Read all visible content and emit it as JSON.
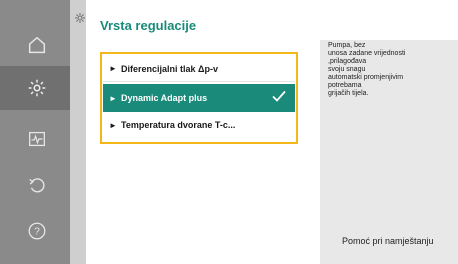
{
  "header": {
    "title": "Vrsta regulacije"
  },
  "nav": {
    "items": [
      {
        "icon": "home-icon",
        "active": false
      },
      {
        "icon": "gear-icon",
        "active": true
      },
      {
        "icon": "pulse-icon",
        "active": false
      },
      {
        "icon": "undo-icon",
        "active": false
      },
      {
        "icon": "help-icon",
        "active": false
      }
    ]
  },
  "list": {
    "items": [
      {
        "label": "Diferencijalni tlak Δp-v",
        "selected": false
      },
      {
        "label": "Dynamic Adapt plus",
        "selected": true
      },
      {
        "label": "Temperatura dvorane T-c...",
        "selected": false
      }
    ]
  },
  "help": {
    "lines": [
      "Pumpa, bez",
      "unosa zadane vrijednosti",
      ",prilagođava",
      "svoju snagu",
      "automatski promjenjivim",
      "potrebama",
      "grijačih tijela."
    ],
    "footer": "Pomoć pri namještanju"
  },
  "colors": {
    "accent": "#1a8a7a",
    "focus": "#f3b71a",
    "rail": "#8a8a8a"
  }
}
